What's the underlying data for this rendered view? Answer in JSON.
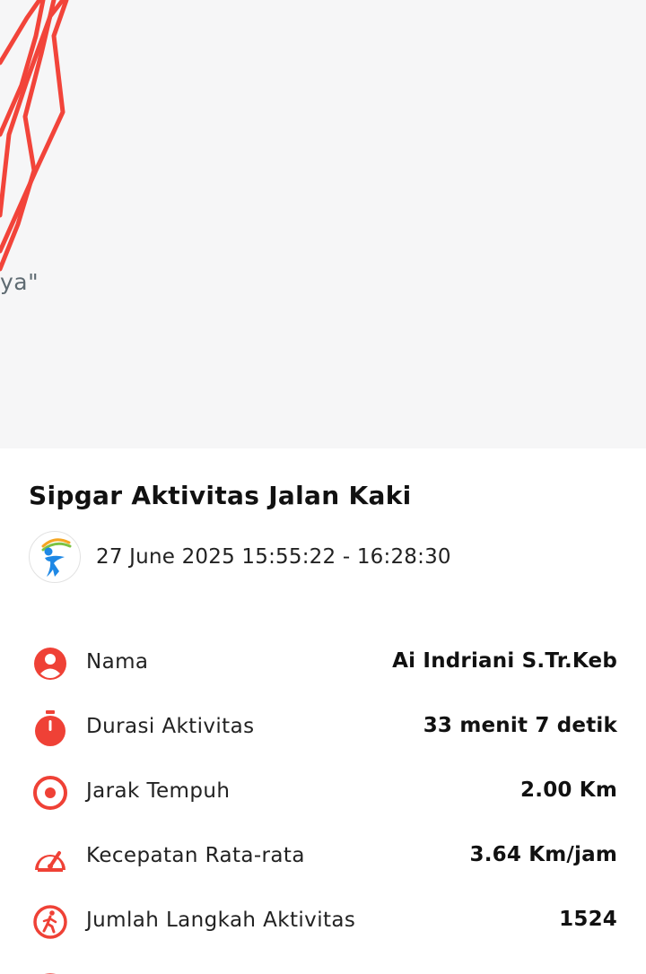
{
  "map": {
    "place_label_fragment": "ya\"",
    "route_color": "#f2443a"
  },
  "activity": {
    "title": "Sipgar Aktivitas Jalan Kaki",
    "datetime": "27 June 2025 15:55:22 - 16:28:30",
    "logo_icon": "walking-figure-logo-icon"
  },
  "details": [
    {
      "icon": "person-icon",
      "label": "Nama",
      "value": "Ai Indriani S.Tr.Keb"
    },
    {
      "icon": "stopwatch-icon",
      "label": "Durasi Aktivitas",
      "value": "33 menit 7 detik"
    },
    {
      "icon": "target-icon",
      "label": "Jarak Tempuh",
      "value": "2.00 Km"
    },
    {
      "icon": "speedometer-icon",
      "label": "Kecepatan Rata-rata",
      "value": "3.64 Km/jam"
    },
    {
      "icon": "walking-icon",
      "label": "Jumlah Langkah Aktivitas",
      "value": "1524"
    }
  ],
  "colors": {
    "accent": "#ef4136",
    "text": "#111111",
    "map_bg": "#f6f6f7"
  }
}
